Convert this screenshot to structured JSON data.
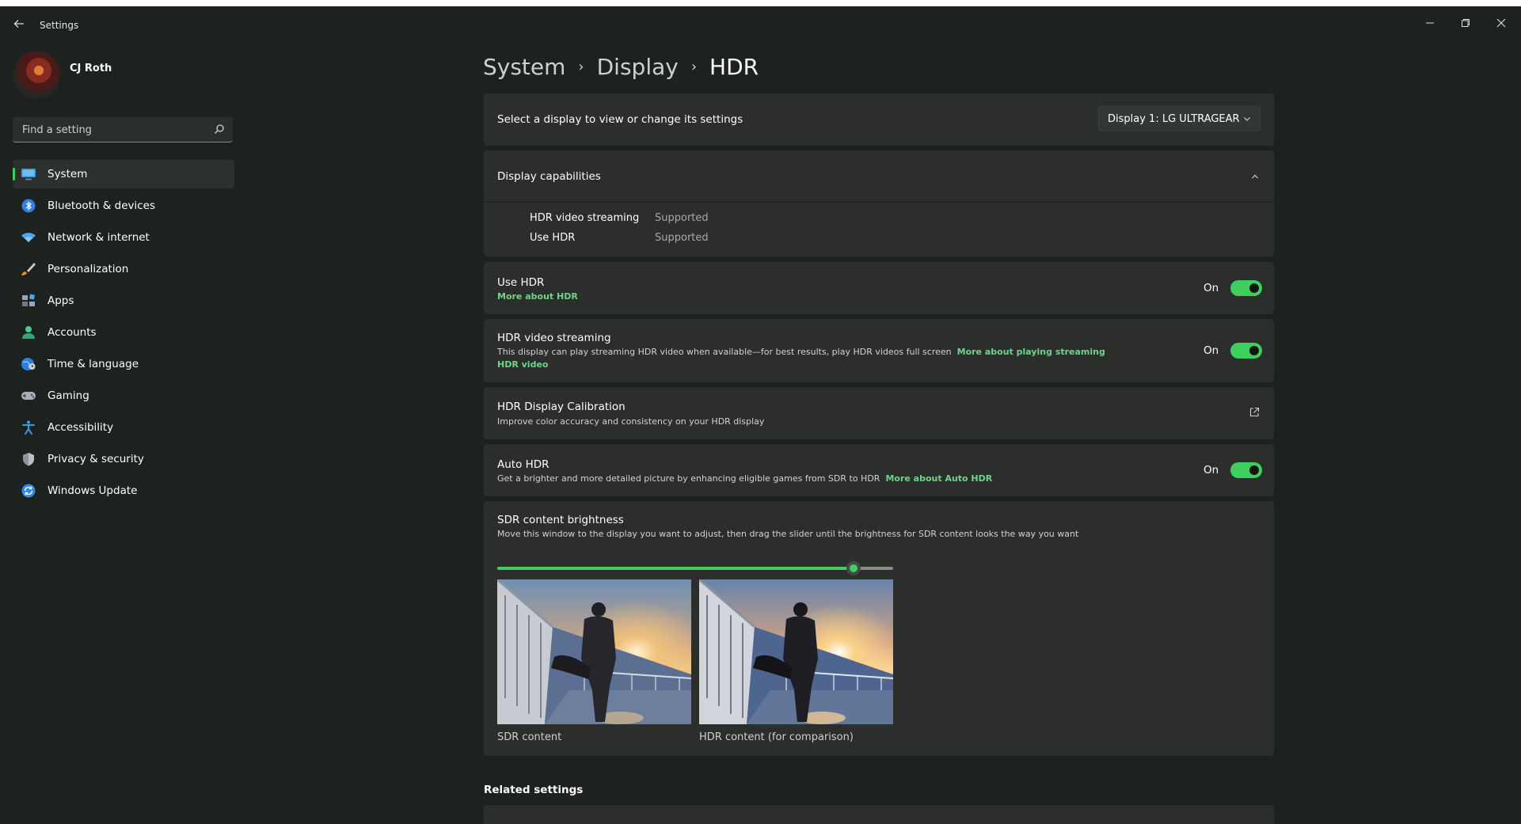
{
  "window": {
    "title": "Settings",
    "controls": [
      "minimize-icon",
      "restore-icon",
      "close-icon"
    ]
  },
  "profile": {
    "name": "CJ Roth"
  },
  "search": {
    "placeholder": "Find a setting"
  },
  "sidebar": {
    "items": [
      {
        "label": "System",
        "icon": "monitor-icon",
        "selected": true
      },
      {
        "label": "Bluetooth & devices",
        "icon": "bluetooth-icon"
      },
      {
        "label": "Network & internet",
        "icon": "wifi-icon"
      },
      {
        "label": "Personalization",
        "icon": "brush-icon"
      },
      {
        "label": "Apps",
        "icon": "apps-icon"
      },
      {
        "label": "Accounts",
        "icon": "person-icon"
      },
      {
        "label": "Time & language",
        "icon": "globe-clock-icon"
      },
      {
        "label": "Gaming",
        "icon": "gamepad-icon"
      },
      {
        "label": "Accessibility",
        "icon": "accessibility-icon"
      },
      {
        "label": "Privacy & security",
        "icon": "shield-icon"
      },
      {
        "label": "Windows Update",
        "icon": "update-icon"
      }
    ]
  },
  "breadcrumb": {
    "items": [
      "System",
      "Display",
      "HDR"
    ]
  },
  "display_select": {
    "label": "Select a display to view or change its settings",
    "value": "Display 1: LG ULTRAGEAR"
  },
  "capabilities": {
    "title": "Display capabilities",
    "rows": [
      {
        "label": "HDR video streaming",
        "value": "Supported"
      },
      {
        "label": "Use HDR",
        "value": "Supported"
      }
    ]
  },
  "use_hdr": {
    "title": "Use HDR",
    "link": "More about HDR",
    "state": "On"
  },
  "hdr_streaming": {
    "title": "HDR video streaming",
    "desc": "This display can play streaming HDR video when available—for best results, play HDR videos full screen",
    "link": "More about playing streaming HDR video",
    "state": "On"
  },
  "calibration": {
    "title": "HDR Display Calibration",
    "desc": "Improve color accuracy and consistency on your HDR display"
  },
  "auto_hdr": {
    "title": "Auto HDR",
    "desc": "Get a brighter and more detailed picture by enhancing eligible games from SDR to HDR",
    "link": "More about Auto HDR",
    "state": "On"
  },
  "sdr_brightness": {
    "title": "SDR content brightness",
    "desc": "Move this window to the display you want to adjust, then drag the slider until the brightness for SDR content looks the way you want",
    "value_fraction": 0.9,
    "sdr_caption": "SDR content",
    "hdr_caption": "HDR content (for comparison)"
  },
  "related": {
    "heading": "Related settings"
  },
  "colors": {
    "accent": "#3ecf5e",
    "link": "#6fd48a",
    "card": "#2b2e2b",
    "background": "#1e221f"
  }
}
